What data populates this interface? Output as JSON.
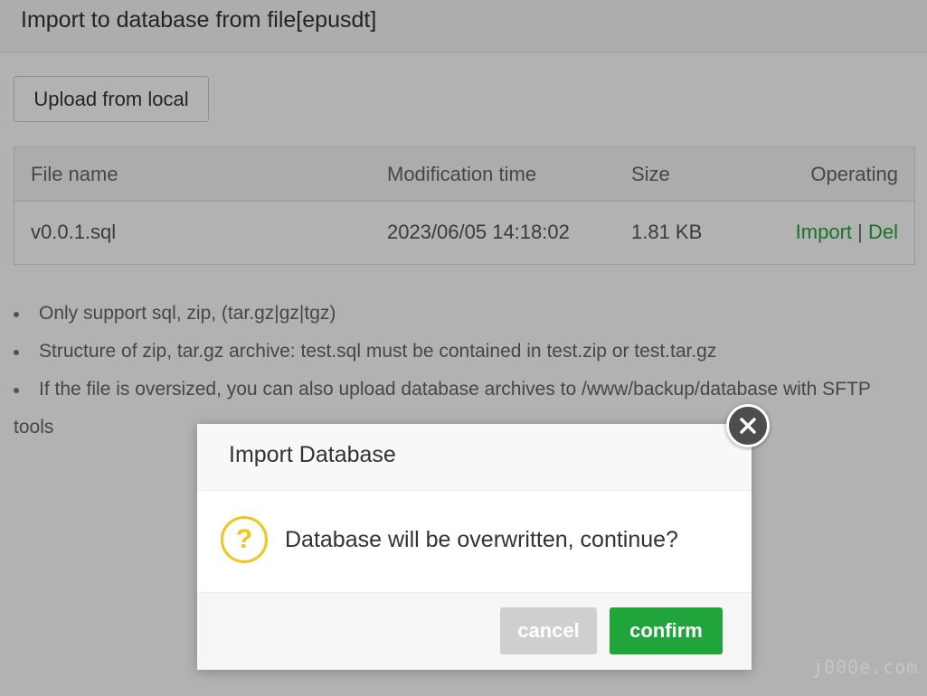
{
  "window": {
    "title": "Import to database from file[epusdt]",
    "upload_label": "Upload from local"
  },
  "table": {
    "headers": {
      "name": "File name",
      "time": "Modification time",
      "size": "Size",
      "operating": "Operating"
    },
    "rows": [
      {
        "name": "v0.0.1.sql",
        "time": "2023/06/05 14:18:02",
        "size": "1.81 KB",
        "import_label": "Import",
        "separator": "|",
        "del_label": "Del"
      }
    ]
  },
  "notes": [
    "Only support sql, zip, (tar.gz|gz|tgz)",
    "Structure of zip, tar.gz archive: test.sql must be contained in test.zip or test.tar.gz",
    "If the file is oversized, you can also upload database archives to /www/backup/database with SFTP tools"
  ],
  "dialog": {
    "title": "Import Database",
    "icon": "question-icon",
    "message": "Database will be overwritten, continue?",
    "cancel_label": "cancel",
    "confirm_label": "confirm"
  },
  "watermark": "j000e.com",
  "colors": {
    "accent": "#20a53a",
    "warning": "#f3c517"
  }
}
